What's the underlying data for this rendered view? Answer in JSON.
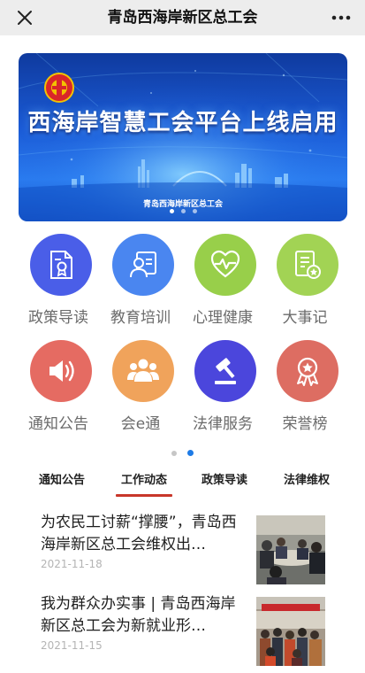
{
  "topbar": {
    "title": "青岛西海岸新区总工会",
    "close_icon": "close-icon",
    "more_icon": "more-icon"
  },
  "banner": {
    "headline": "西海岸智慧工会平台上线启用",
    "sub": "青岛西海岸新区总工会",
    "slide_count": 3,
    "active_slide": 1
  },
  "grid": {
    "items": [
      {
        "label": "政策导读",
        "icon": "policy-document-icon",
        "color": "#4a5ee8"
      },
      {
        "label": "教育培训",
        "icon": "training-icon",
        "color": "#4a86f0"
      },
      {
        "label": "心理健康",
        "icon": "heart-icon",
        "color": "#98cf4a"
      },
      {
        "label": "大事记",
        "icon": "records-icon",
        "color": "#a2d354"
      },
      {
        "label": "通知公告",
        "icon": "megaphone-icon",
        "color": "#e56b62"
      },
      {
        "label": "会e通",
        "icon": "people-icon",
        "color": "#f0a35b"
      },
      {
        "label": "法律服务",
        "icon": "gavel-icon",
        "color": "#4b46dc"
      },
      {
        "label": "荣誉榜",
        "icon": "medal-icon",
        "color": "#dd6d62"
      }
    ],
    "pages": 2,
    "active_page": 2
  },
  "tabs": {
    "items": [
      "通知公告",
      "工作动态",
      "政策导读",
      "法律维权"
    ],
    "active": 1
  },
  "news": {
    "items": [
      {
        "title": "为农民工讨薪“撑腰”，青岛西海岸新区总工会维权出…",
        "date": "2021-11-18"
      },
      {
        "title": "我为群众办实事 | 青岛西海岸新区总工会为新就业形…",
        "date": "2021-11-15"
      }
    ]
  },
  "colors": {
    "accent_underline": "#c8362a",
    "pager_active": "#1e7be6",
    "topbar_bg": "#ededed"
  }
}
